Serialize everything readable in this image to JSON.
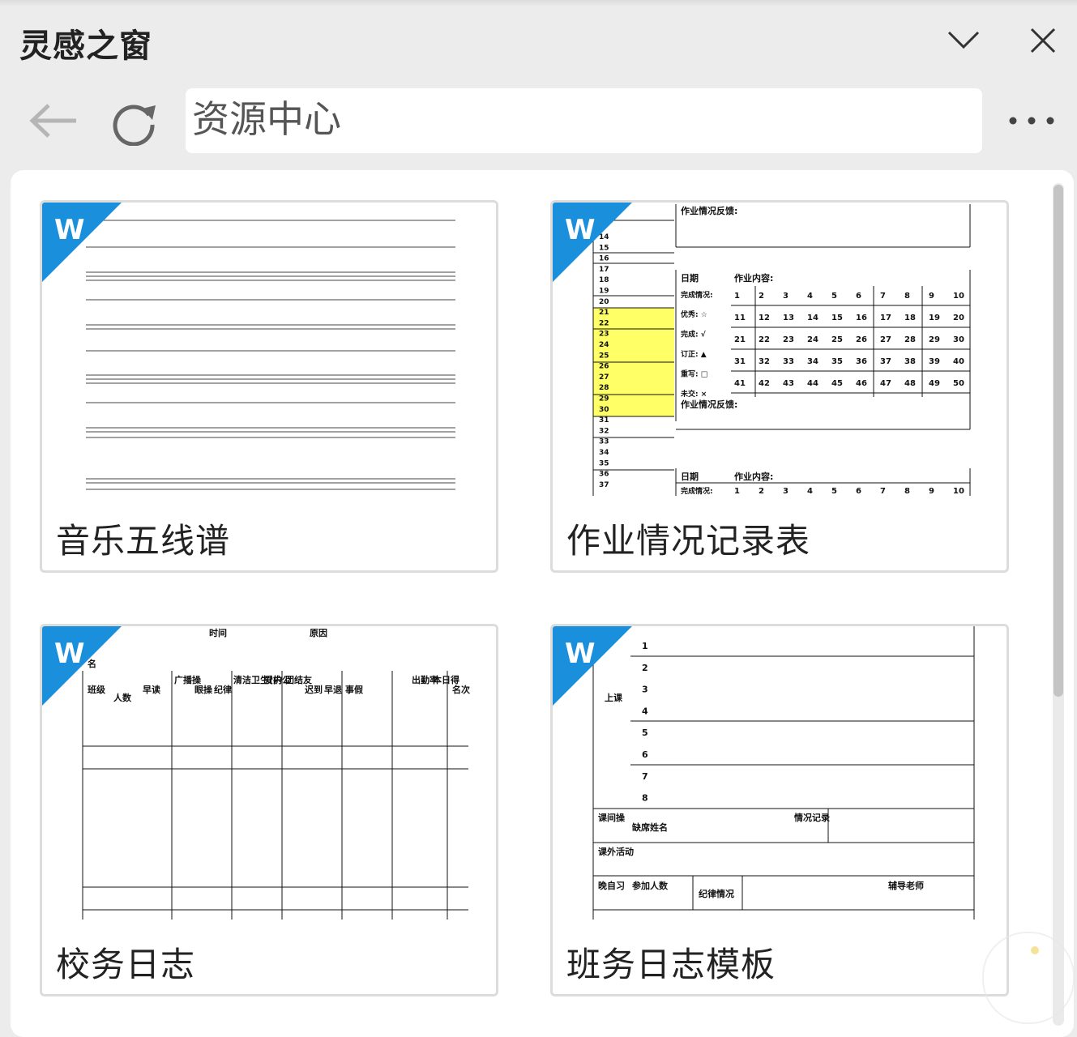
{
  "window": {
    "title": "灵感之窗",
    "collapse_icon": "chevron-down-icon",
    "close_icon": "close-icon"
  },
  "toolbar": {
    "back_icon": "arrow-left-icon",
    "refresh_icon": "refresh-icon",
    "address_value": "资源中心",
    "more_icon": "more-horizontal-icon"
  },
  "cards": [
    {
      "title": "音乐五线谱",
      "badge": "W"
    },
    {
      "title": "作业情况记录表",
      "badge": "W"
    },
    {
      "title": "校务日志",
      "badge": "W"
    },
    {
      "title": "班务日志模板",
      "badge": "W"
    }
  ],
  "colors": {
    "badge_blue": "#1a8fdb",
    "highlight_yellow": "#ffff66",
    "background": "#ececec"
  },
  "preview_text": {
    "homework": {
      "feedback_label": "作业情况反馈:",
      "date_label": "日期",
      "content_label": "作业内容:",
      "status_label": "完成情况:",
      "legend": [
        "优秀: ☆",
        "完成: √",
        "订正: ▲",
        "重写: □",
        "未交: ×"
      ],
      "row_numbers": [
        "14",
        "15",
        "16",
        "17",
        "18",
        "19",
        "20",
        "21",
        "22",
        "23",
        "24",
        "25",
        "26",
        "27",
        "28",
        "29",
        "30",
        "31",
        "32",
        "33",
        "34",
        "35",
        "36",
        "37"
      ],
      "grid": [
        [
          "1",
          "2",
          "3",
          "4",
          "5",
          "6",
          "7",
          "8",
          "9",
          "10"
        ],
        [
          "11",
          "12",
          "13",
          "14",
          "15",
          "16",
          "17",
          "18",
          "19",
          "20"
        ],
        [
          "21",
          "22",
          "23",
          "24",
          "25",
          "26",
          "27",
          "28",
          "29",
          "30"
        ],
        [
          "31",
          "32",
          "33",
          "34",
          "35",
          "36",
          "37",
          "38",
          "39",
          "40"
        ],
        [
          "41",
          "42",
          "43",
          "44",
          "45",
          "46",
          "47",
          "48",
          "49",
          "50"
        ]
      ]
    },
    "school_log": {
      "header_time": "时间",
      "header_reason": "原因",
      "name_label": "名",
      "class_label": "班级",
      "count_label": "人数",
      "morning_read": "早读",
      "broadcast_exercise": "广播操",
      "eye_exercise": "眼操",
      "discipline": "纪律",
      "cleaning": "清洁卫生(内",
      "care_public": "爱护公",
      "unity": "团结友",
      "late": "迟到",
      "early_leave": "早退",
      "leave": "事假",
      "attendance": "出勤率",
      "today_score": "本日得",
      "rank": "名次"
    },
    "class_log": {
      "lesson_label": "上课",
      "periods": [
        "1",
        "2",
        "3",
        "4",
        "5",
        "6",
        "7",
        "8"
      ],
      "break_exercise": "课间操",
      "absent_names": "缺席姓名",
      "situation_record": "情况记录",
      "extracurricular": "课外活动",
      "evening_study": "晚自习",
      "participants": "参加人数",
      "discipline_status": "纪律情况",
      "tutor": "辅导老师"
    }
  }
}
